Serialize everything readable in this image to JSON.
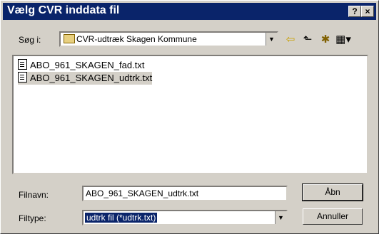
{
  "window": {
    "title": "Vælg CVR inddata fil",
    "help_btn": "?",
    "close_btn": "×"
  },
  "lookin": {
    "label": "Søg i:",
    "value": "CVR-udtræk Skagen Kommune"
  },
  "toolbar": {
    "back_icon": "back-arrow-icon",
    "up_icon": "up-folder-icon",
    "new_folder_icon": "new-folder-icon",
    "view_icon": "view-menu-icon"
  },
  "files": [
    {
      "name": "ABO_961_SKAGEN_fad.txt",
      "selected": false
    },
    {
      "name": "ABO_961_SKAGEN_udtrk.txt",
      "selected": true
    }
  ],
  "filename": {
    "label": "Filnavn:",
    "value": "ABO_961_SKAGEN_udtrk.txt"
  },
  "filetype": {
    "label": "Filtype:",
    "value": "udtrk fil (*udtrk.txt)"
  },
  "buttons": {
    "open": "Åbn",
    "cancel": "Annuller"
  }
}
